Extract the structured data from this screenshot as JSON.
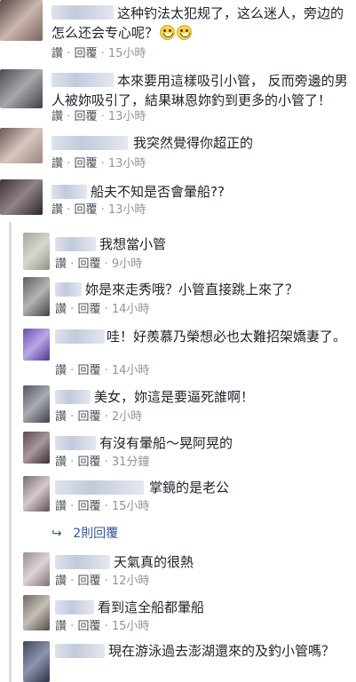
{
  "comments": [
    {
      "text": "这种钓法太犯规了，这么迷人，旁边的怎么还会专心呢？",
      "emoji_count": 2,
      "like": "讚",
      "reply": "回覆",
      "time": "15小時"
    },
    {
      "text": "本來要用這樣吸引小管， 反而旁邊的男人被妳吸引了，結果琳恩妳釣到更多的小管了！",
      "like": "讚",
      "reply": "回覆",
      "time": "13小時"
    },
    {
      "text": "我突然覺得你超正的",
      "like": "讚",
      "reply": "回覆",
      "time": "13小時"
    },
    {
      "text": "船夫不知是否會暈船??",
      "like": "讚",
      "reply": "回覆",
      "time": "13小時"
    },
    {
      "text": "我想當小管",
      "like": "讚",
      "reply": "回覆",
      "time": "9小時"
    },
    {
      "text": "妳是來走秀哦？小管直接跳上來了？",
      "like": "讚",
      "reply": "回覆",
      "time": "14小時"
    },
    {
      "text": "哇！好羨慕乃榮想必也太難招架嬌妻了。",
      "like": "讚",
      "reply": "回覆",
      "time": "14小時"
    },
    {
      "text": "美女，妳這是要逼死誰啊！",
      "like": "讚",
      "reply": "回覆",
      "time": "2小時"
    },
    {
      "text": "有沒有暈船～晃阿晃的",
      "like": "讚",
      "reply": "回覆",
      "time": "31分鐘"
    },
    {
      "text": "掌鏡的是老公",
      "like": "讚",
      "reply": "回覆",
      "time": "15小時"
    },
    {
      "text": "天氣真的很熱",
      "like": "讚",
      "reply": "回覆",
      "time": "12小時"
    },
    {
      "text": "看到這全船都暈船",
      "like": "讚",
      "reply": "回覆",
      "time": "15小時"
    },
    {
      "text": "現在游泳過去澎湖還來的及釣小管嗎？"
    }
  ],
  "more_replies": {
    "arrow": "↪",
    "label": "2則回覆"
  },
  "meta_separator": "·",
  "colors": {
    "link": "#365899",
    "meta": "#90949c",
    "text": "#1d2129"
  }
}
